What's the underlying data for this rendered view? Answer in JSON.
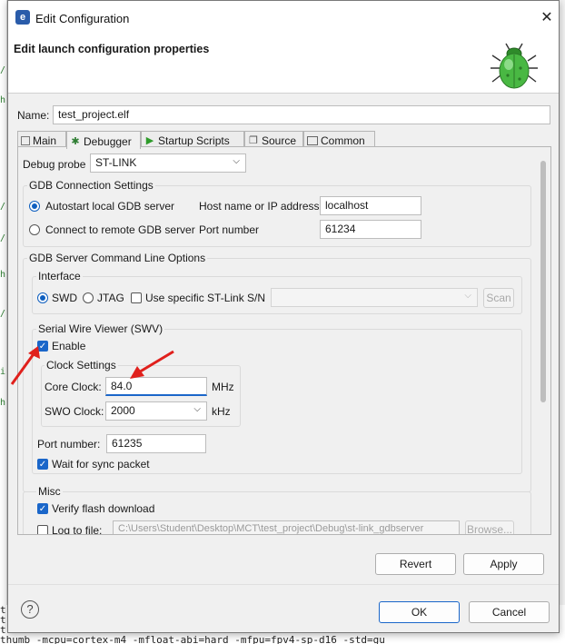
{
  "window": {
    "title": "Edit Configuration",
    "app_icon": "eclipse-icon"
  },
  "header": {
    "title": "Edit launch configuration properties",
    "image": "bug-icon"
  },
  "name_row": {
    "label": "Name:",
    "value": "test_project.elf"
  },
  "tabs": [
    {
      "label": "Main",
      "icon": "main-icon",
      "selected": false
    },
    {
      "label": "Debugger",
      "icon": "debugger-icon",
      "selected": true
    },
    {
      "label": "Startup Scripts",
      "icon": "play-icon",
      "selected": false
    },
    {
      "label": "Source",
      "icon": "source-icon",
      "selected": false
    },
    {
      "label": "Common",
      "icon": "common-icon",
      "selected": false
    }
  ],
  "debugger": {
    "probe_label": "Debug probe",
    "probe_value": "ST-LINK",
    "gdb_connection": {
      "title": "GDB Connection Settings",
      "autostart_label": "Autostart local GDB server",
      "remote_label": "Connect to remote GDB server",
      "host_label": "Host name or IP address",
      "host_value": "localhost",
      "port_label": "Port number",
      "port_value": "61234"
    },
    "gdb_server_options": {
      "title": "GDB Server Command Line Options",
      "interface": {
        "title": "Interface",
        "swd_label": "SWD",
        "jtag_label": "JTAG",
        "specific_stlink_label": "Use specific ST-Link S/N",
        "scan_label": "Scan"
      },
      "swv": {
        "title": "Serial Wire Viewer (SWV)",
        "enable_label": "Enable",
        "clock_settings": {
          "title": "Clock Settings",
          "core_label": "Core Clock:",
          "core_value": "84.0",
          "core_unit": "MHz",
          "swo_label": "SWO Clock:",
          "swo_value": "2000",
          "swo_unit": "kHz"
        },
        "port_label": "Port number:",
        "port_value": "61235",
        "wait_sync_label": "Wait for sync packet"
      }
    },
    "misc": {
      "title": "Misc",
      "verify_label": "Verify flash download",
      "log_label": "Log to file:",
      "log_path": "C:\\Users\\Student\\Desktop\\MCT\\test_project\\Debug\\st-link_gdbserver",
      "browse_label": "Browse..."
    }
  },
  "buttons": {
    "revert": "Revert",
    "apply": "Apply",
    "ok": "OK",
    "cancel": "Cancel"
  },
  "background": {
    "left_glyphs": [
      "/",
      "h",
      "/",
      "h",
      "/",
      "/",
      "i",
      "h"
    ],
    "bottom_lines": [
      "t",
      "t",
      "t",
      "thumb -mcpu=cortex-m4 -mfloat-abi=hard -mfpu=fpv4-sp-d16 -std=gu"
    ]
  },
  "colors": {
    "accent": "#1a66c9",
    "annotation_arrow": "#e0201c",
    "bug_green": "#3fae3a"
  }
}
